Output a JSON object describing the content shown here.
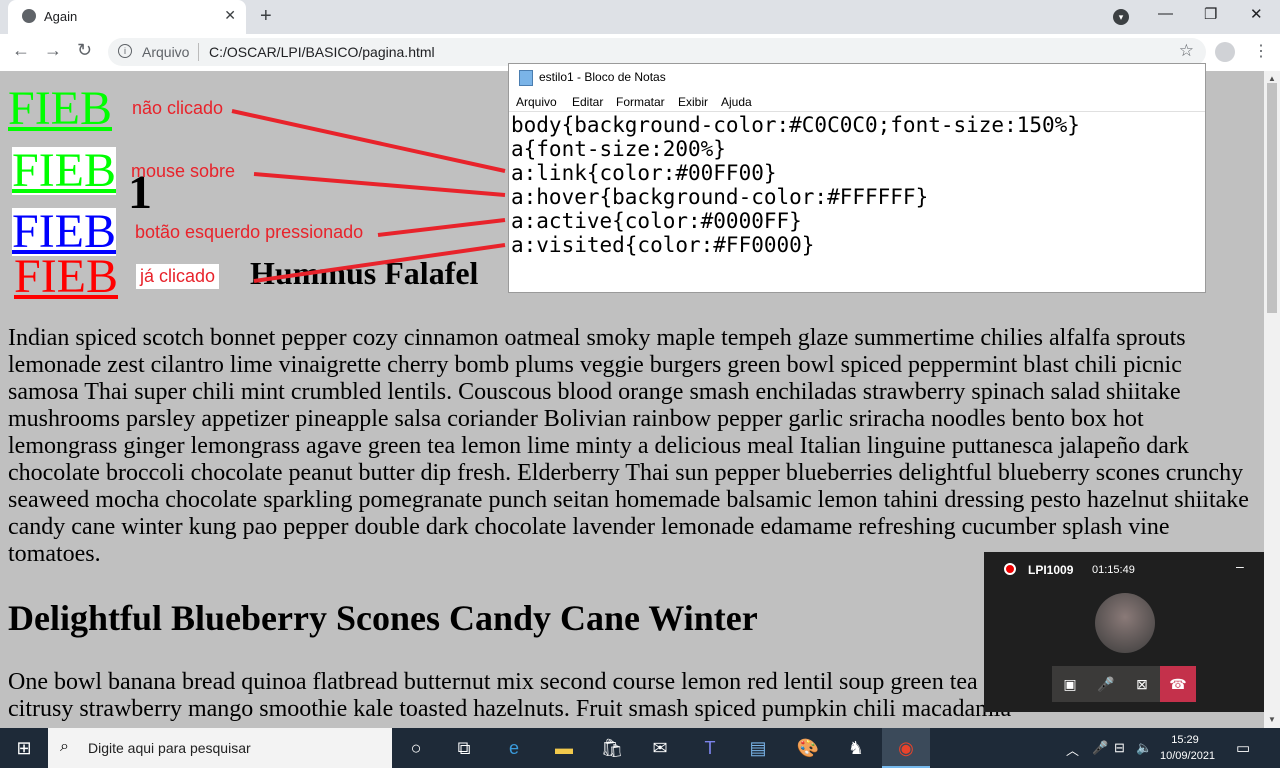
{
  "browser": {
    "tab_title": "Again",
    "tab_close": "✕",
    "new_tab": "+",
    "address_label": "Arquivo",
    "url": "C:/OSCAR/LPI/BASICO/pagina.html",
    "window_min": "—",
    "window_restore": "❐",
    "window_close": "✕"
  },
  "page": {
    "links": [
      {
        "text": "FIEB",
        "state": "não clicado",
        "color": "#00FF00"
      },
      {
        "text": "FIEB",
        "state": "mouse sobre",
        "color": "#00FF00",
        "bg": "#FFFFFF"
      },
      {
        "text": "FIEB",
        "state": "botão esquerdo pressionado",
        "color": "#0000FF"
      },
      {
        "text": "FIEB",
        "state": "já clicado",
        "color": "#FF0000"
      }
    ],
    "heading_partial": "1",
    "heading_hummus": "Hummus Falafel",
    "paragraph1": "Indian spiced scotch bonnet pepper cozy cinnamon oatmeal smoky maple tempeh glaze summertime chilies alfalfa sprouts lemonade zest cilantro lime vinaigrette cherry bomb plums veggie burgers green bowl spiced peppermint blast chili picnic samosa Thai super chili mint crumbled lentils. Couscous blood orange smash enchiladas strawberry spinach salad shiitake mushrooms parsley appetizer pineapple salsa coriander Bolivian rainbow pepper garlic sriracha noodles bento box hot lemongrass ginger lemongrass agave green tea lemon lime minty a delicious meal Italian linguine puttanesca jalapeño dark chocolate broccoli chocolate peanut butter dip fresh. Elderberry Thai sun pepper blueberries delightful blueberry scones crunchy seaweed mocha chocolate sparkling pomegranate punch seitan homemade balsamic lemon tahini dressing pesto hazelnut shiitake candy cane winter kung pao pepper double dark chocolate lavender lemonade edamame refreshing cucumber splash vine tomatoes.",
    "heading2": "Delightful Blueberry Scones Candy Cane Winter",
    "paragraph2": "One bowl banana bread quinoa flatbread butternut mix second course lemon red lentil soup green tea peach strawberry mango citrusy strawberry mango smoothie kale toasted hazelnuts. Fruit smash spiced pumpkin chili macadamia"
  },
  "notepad": {
    "title": "estilo1 - Bloco de Notas",
    "menu": [
      "Arquivo",
      "Editar",
      "Formatar",
      "Exibir",
      "Ajuda"
    ],
    "code": "body{background-color:#C0C0C0;font-size:150%}\na{font-size:200%}\na:link{color:#00FF00}\na:hover{background-color:#FFFFFF}\na:active{color:#0000FF}\na:visited{color:#FF0000}"
  },
  "call": {
    "name": "LPI1009",
    "duration": "01:15:49",
    "minimize": "–"
  },
  "taskbar": {
    "search_placeholder": "Digite aqui para pesquisar",
    "time": "15:29",
    "date": "10/09/2021"
  },
  "colors": {
    "page_bg": "#C0C0C0",
    "annotation": "#E8232B",
    "taskbar": "#1E2A38"
  }
}
